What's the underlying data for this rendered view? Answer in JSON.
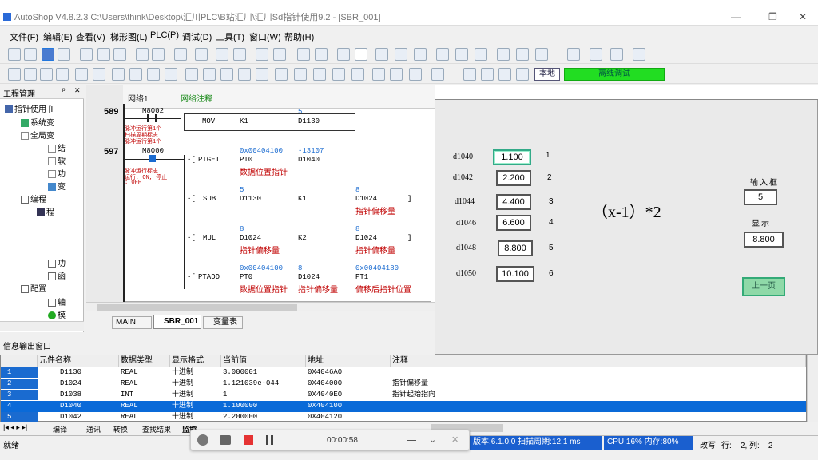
{
  "window": {
    "title": "AutoShop V4.8.2.3  C:\\Users\\think\\Desktop\\汇川PLC\\B站汇川\\汇川Sd指针使用9.2 - [SBR_001]",
    "minimize": "—",
    "restore": "❐",
    "close": "✕"
  },
  "menu": [
    "文件(F)",
    "编辑(E)",
    "查看(V)",
    "梯形图(L)",
    "PLC(P)",
    "调试(D)",
    "工具(T)",
    "窗口(W)",
    "帮助(H)"
  ],
  "toolbar": {
    "local_label": "本地",
    "offline_label": "离线调试"
  },
  "project": {
    "title": "工程管理",
    "pin": "ᵖ",
    "close": "✕",
    "items": [
      "指针使用 [I",
      "系统变",
      "全局变",
      "结",
      "软",
      "功",
      "变",
      "编程",
      "程",
      "功",
      "函",
      "配置",
      "轴",
      "模"
    ]
  },
  "ladder": {
    "network_label": "网络1",
    "network_comment": "网络注释",
    "lines": {
      "n589": "589",
      "n597": "597",
      "m8002": "M8002",
      "m8000": "M8000",
      "note1a": "脉冲运行第1个",
      "note1b": "扫描周期标志",
      "note1c": "脉冲运行第1个",
      "note2a": "脉冲运行标志",
      "note2b": "运行, ON, 停止",
      "note2c": ": OFF",
      "mov": "MOV",
      "k1": "K1",
      "v5": "5",
      "d1130": "D1130",
      "ptget": "PTGET",
      "addr1": "0x00404100",
      "neg": "-13107",
      "pt0": "PT0",
      "d1040": "D1040",
      "dpp": "数据位置指针",
      "sub": "SUB",
      "s5": "5",
      "s8": "8",
      "sd1130": "D1130",
      "sk1": "K1",
      "sd1024": "D1024",
      "ptrmove": "指针偏移量",
      "mul": "MUL",
      "m8a": "8",
      "m8b": "8",
      "md1024": "D1024",
      "k2": "K2",
      "md1024b": "D1024",
      "ptrmove2": "指针偏移量",
      "ptrmove3": "指针偏移量",
      "ptadd": "PTADD",
      "addr2": "0x00404100",
      "a8": "8",
      "addr3": "0x00404180",
      "apt0": "PT0",
      "ad1024": "D1024",
      "pt1": "PT1",
      "dpp2": "数据位置指针",
      "ptrmove4": "指针偏移量",
      "offset": "偏移后指针位置"
    },
    "tabs": [
      "MAIN",
      "SBR_001",
      "变量表"
    ]
  },
  "hmi": {
    "rows": [
      {
        "label": "d1040",
        "value": "1.100",
        "idx": "1"
      },
      {
        "label": "d1042",
        "value": "2.200",
        "idx": "2"
      },
      {
        "label": "d1044",
        "value": "4.400",
        "idx": "3"
      },
      {
        "label": "d1046",
        "value": "6.600",
        "idx": "4"
      },
      {
        "label": "d1048",
        "value": "8.800",
        "idx": "5"
      },
      {
        "label": "d1050",
        "value": "10.100",
        "idx": "6"
      }
    ],
    "formula": "（x-1）*2",
    "input_label": "输入框",
    "input_value": "5",
    "display_label": "显示",
    "display_value": "8.800",
    "prev_button": "上一页"
  },
  "output": {
    "title": "信息输出窗口",
    "headers": [
      "元件名称",
      "数据类型",
      "显示格式",
      "当前值",
      "地址",
      "注释"
    ],
    "rows": [
      {
        "n": "1",
        "name": "D1130",
        "type": "REAL",
        "fmt": "十进制",
        "val": "3.000001",
        "addr": "0X4046A0",
        "note": ""
      },
      {
        "n": "2",
        "name": "D1024",
        "type": "REAL",
        "fmt": "十进制",
        "val": "1.121039e-044",
        "addr": "0X404000",
        "note": "指针偏移量"
      },
      {
        "n": "3",
        "name": "D1038",
        "type": "INT",
        "fmt": "十进制",
        "val": "1",
        "addr": "0X4040E0",
        "note": "指针起始指向"
      },
      {
        "n": "4",
        "name": "D1040",
        "type": "REAL",
        "fmt": "十进制",
        "val": "1.100000",
        "addr": "0X404100",
        "note": ""
      },
      {
        "n": "5",
        "name": "D1042",
        "type": "REAL",
        "fmt": "十进制",
        "val": "2.200000",
        "addr": "0X404120",
        "note": ""
      }
    ],
    "tabs": [
      "编译",
      "通讯",
      "转换",
      "查找结果",
      "监控"
    ]
  },
  "status": {
    "left": "就绪",
    "version": "版本:6.1.0.0 扫描周期:12.1 ms",
    "cpu": "CPU:16%  内存:80%",
    "mode": "改写",
    "pos": "行:    2, 列:    2"
  },
  "recorder": {
    "time": "00:00:58"
  }
}
